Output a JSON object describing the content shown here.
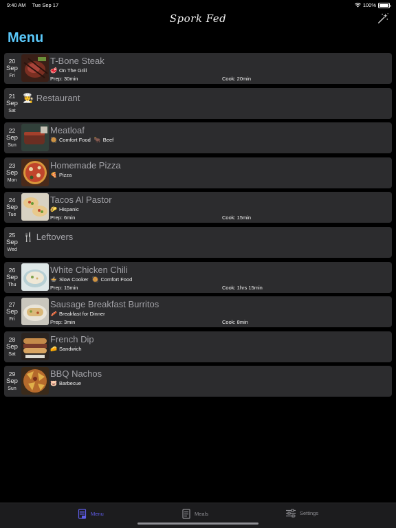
{
  "status_bar": {
    "time": "9:40 AM",
    "date": "Tue Sep 17",
    "battery": "100%",
    "battery_level": 1.0
  },
  "app": {
    "title": "Spork Fed"
  },
  "page": {
    "title": "Menu"
  },
  "days": [
    {
      "day": "20",
      "month": "Sep",
      "weekday": "Fri",
      "meal": "T-Bone Steak",
      "thumb": "steak",
      "tags": [
        {
          "emoji": "🥩",
          "label": "On The Grill"
        }
      ],
      "prep": "Prep: 30min",
      "cook": "Cook: 20min"
    },
    {
      "day": "21",
      "month": "Sep",
      "weekday": "Sat",
      "meal": "🧑‍🍳 Restaurant",
      "thumb": "",
      "tags": [],
      "prep": "",
      "cook": ""
    },
    {
      "day": "22",
      "month": "Sep",
      "weekday": "Sun",
      "meal": "Meatloaf",
      "thumb": "meatloaf",
      "tags": [
        {
          "emoji": "🥘",
          "label": "Comfort Food"
        },
        {
          "emoji": "🐂",
          "label": "Beef"
        }
      ],
      "prep": "",
      "cook": ""
    },
    {
      "day": "23",
      "month": "Sep",
      "weekday": "Mon",
      "meal": "Homemade Pizza",
      "thumb": "pizza",
      "tags": [
        {
          "emoji": "🍕",
          "label": "Pizza"
        }
      ],
      "prep": "",
      "cook": ""
    },
    {
      "day": "24",
      "month": "Sep",
      "weekday": "Tue",
      "meal": "Tacos Al Pastor",
      "thumb": "tacos",
      "tags": [
        {
          "emoji": "🌮",
          "label": "Hispanic"
        }
      ],
      "prep": "Prep: 6min",
      "cook": "Cook: 15min"
    },
    {
      "day": "25",
      "month": "Sep",
      "weekday": "Wed",
      "meal": "🍴 Leftovers",
      "thumb": "",
      "tags": [],
      "prep": "",
      "cook": ""
    },
    {
      "day": "26",
      "month": "Sep",
      "weekday": "Thu",
      "meal": "White Chicken Chili",
      "thumb": "chili",
      "tags": [
        {
          "emoji": "🍲",
          "label": "Slow Cooker"
        },
        {
          "emoji": "🥘",
          "label": "Comfort Food"
        }
      ],
      "prep": "Prep: 15min",
      "cook": "Cook: 1hrs 15min"
    },
    {
      "day": "27",
      "month": "Sep",
      "weekday": "Fri",
      "meal": "Sausage Breakfast Burritos",
      "thumb": "burritos",
      "tags": [
        {
          "emoji": "🥓",
          "label": "Breakfast for Dinner"
        }
      ],
      "prep": "Prep: 3min",
      "cook": "Cook: 8min"
    },
    {
      "day": "28",
      "month": "Sep",
      "weekday": "Sat",
      "meal": "French Dip",
      "thumb": "frenchdip",
      "tags": [
        {
          "emoji": "🧀",
          "label": "Sandwich"
        }
      ],
      "prep": "",
      "cook": ""
    },
    {
      "day": "29",
      "month": "Sep",
      "weekday": "Sun",
      "meal": "BBQ Nachos",
      "thumb": "nachos",
      "tags": [
        {
          "emoji": "🐷",
          "label": "Barbecue"
        }
      ],
      "prep": "",
      "cook": ""
    }
  ],
  "tab_bar": {
    "tabs": [
      {
        "label": "Menu",
        "icon": "menu-book-icon",
        "active": true
      },
      {
        "label": "Meals",
        "icon": "recipe-card-icon",
        "active": false
      },
      {
        "label": "Settings",
        "icon": "sliders-icon",
        "active": false
      }
    ]
  },
  "colors": {
    "accent": "#5ac8fa",
    "active_tab": "#5e5ce6",
    "card": "#2c2c2e",
    "background": "#000000"
  }
}
